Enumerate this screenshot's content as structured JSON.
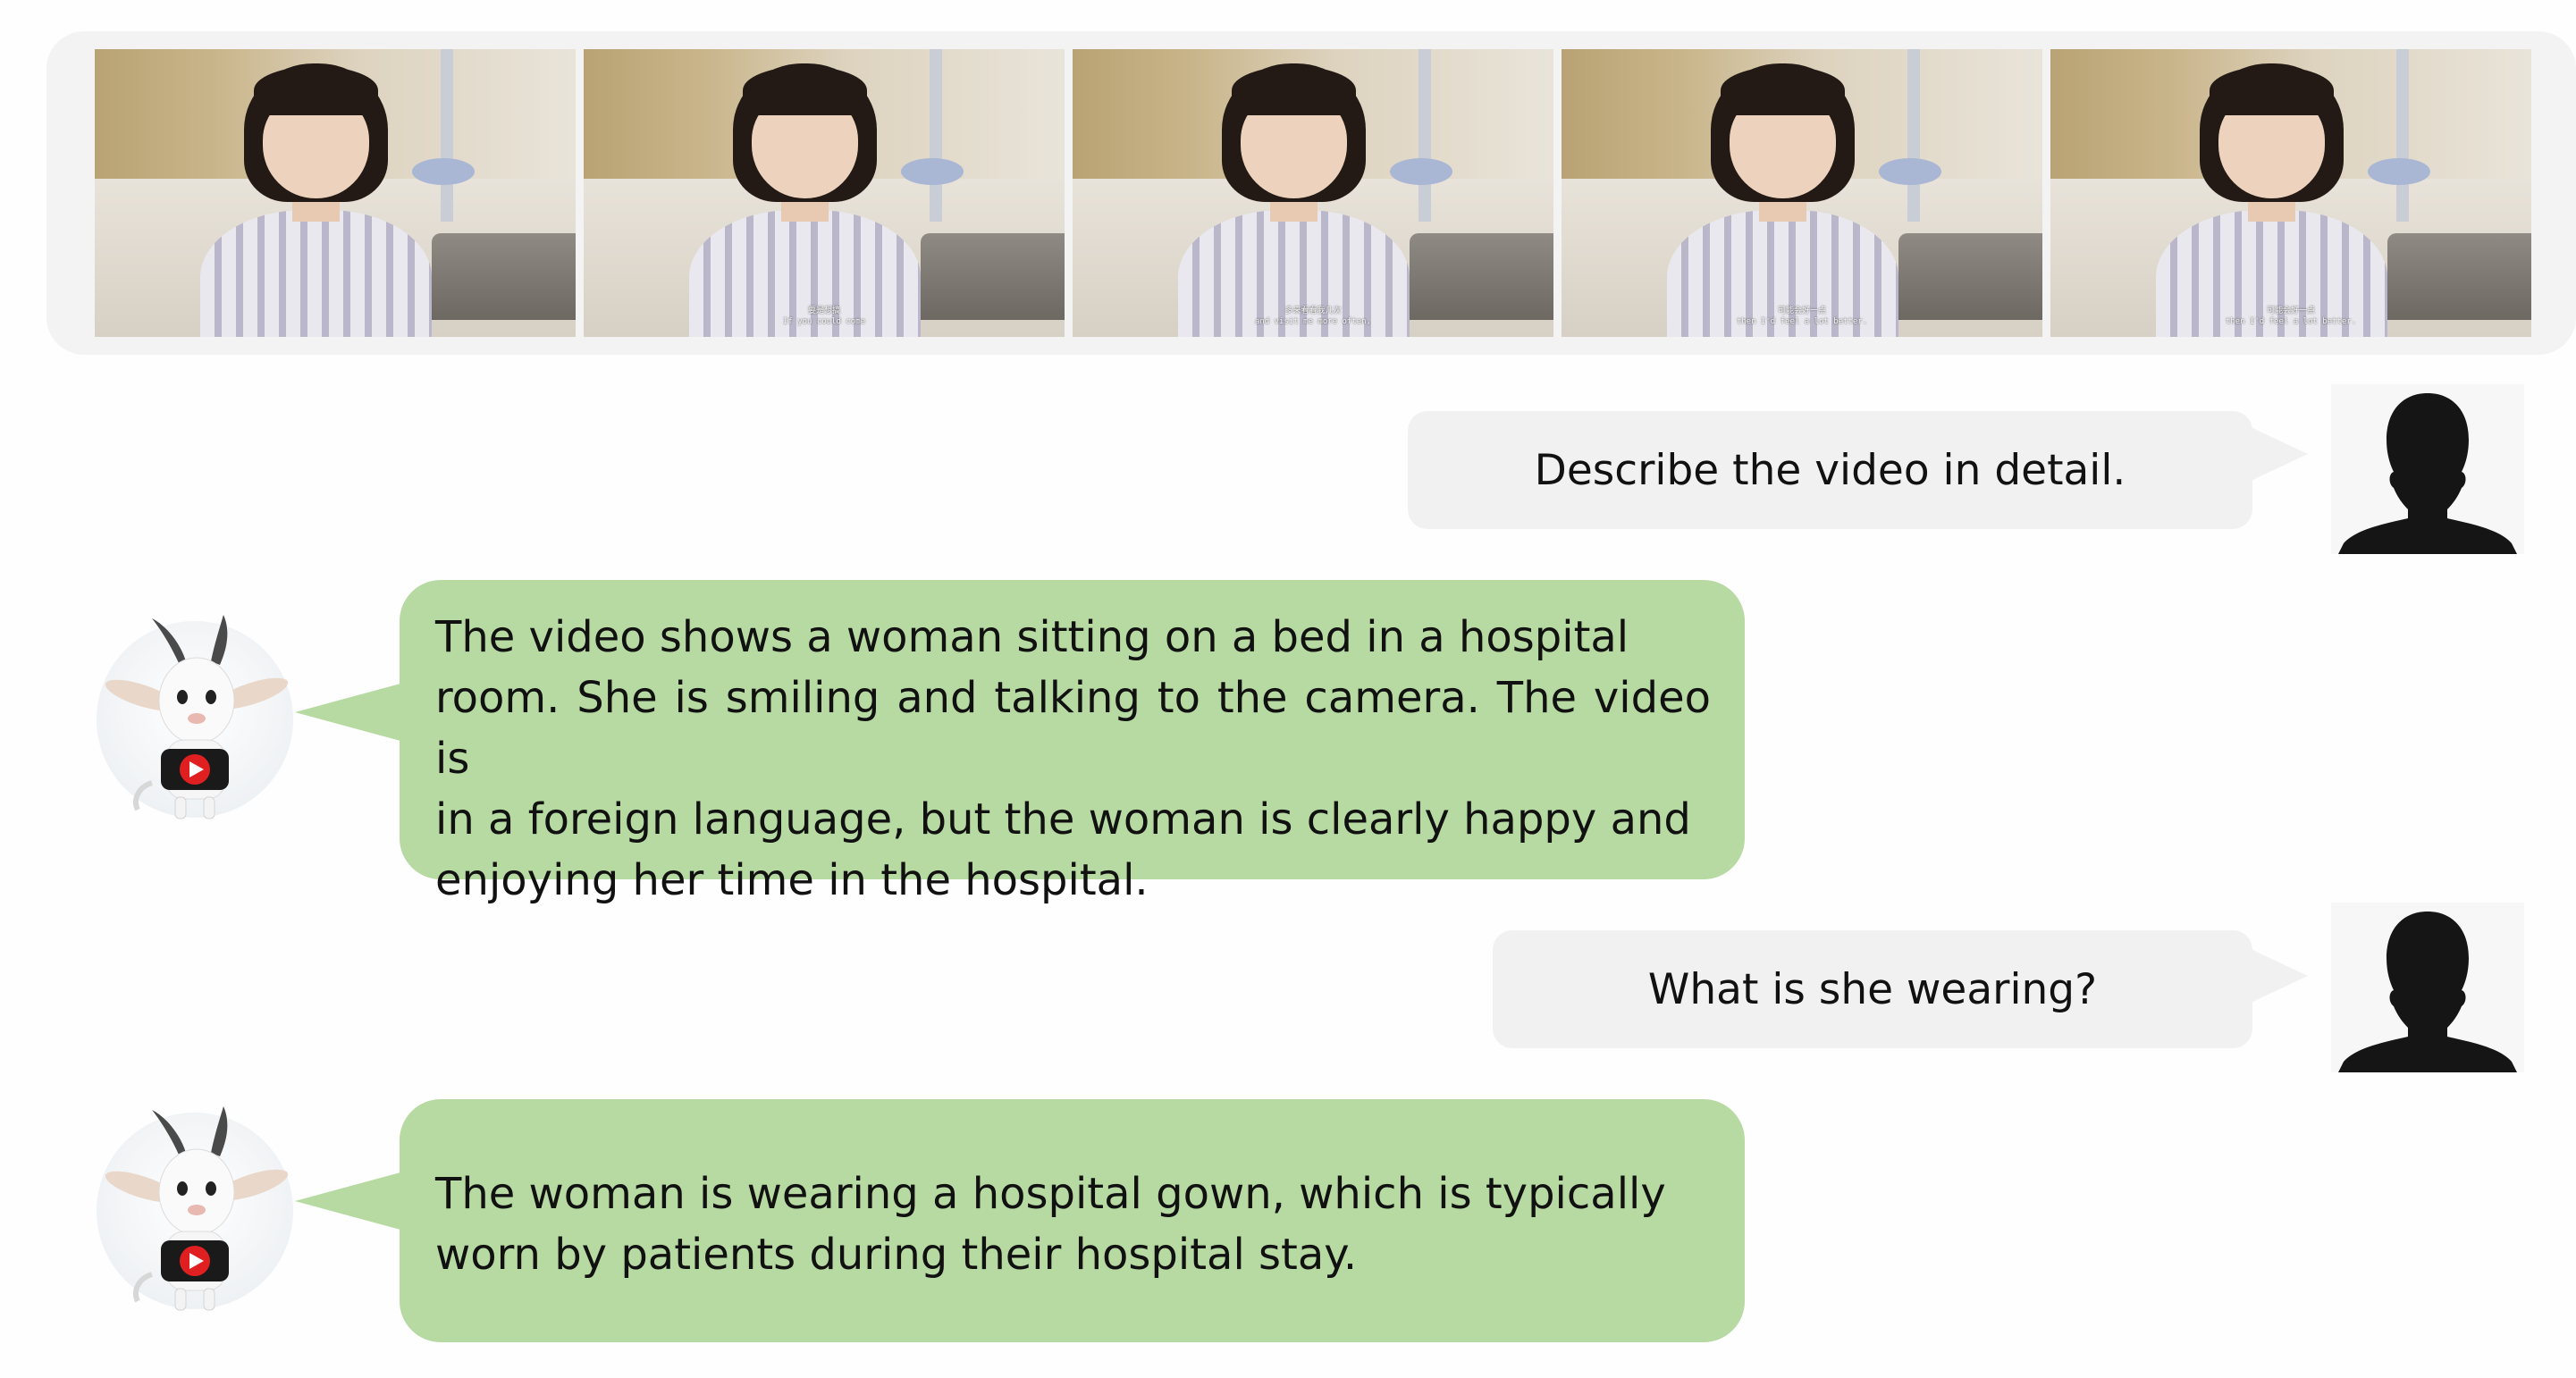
{
  "video": {
    "frames": [
      {
        "sub_zh": "",
        "sub_en": ""
      },
      {
        "sub_zh": "要是想搞",
        "sub_en": "If you could come"
      },
      {
        "sub_zh": "多来看看我几次",
        "sub_en": "and visit me more often,"
      },
      {
        "sub_zh": "可能会好一点",
        "sub_en": "then I'd feel a lot better."
      },
      {
        "sub_zh": "可能会好一点",
        "sub_en": "then I'd feel a lot better."
      }
    ]
  },
  "chat": [
    {
      "role": "user",
      "text": "Describe the video in detail.",
      "avatar_icon": "user-silhouette-icon"
    },
    {
      "role": "assistant",
      "avatar_icon": "goat-mascot-icon",
      "lines": [
        "The video shows a woman sitting on a bed in a hospital",
        "room. She is smiling and talking to the camera. The video is",
        "in a foreign language, but the woman is clearly happy and",
        "enjoying her time in the hospital."
      ]
    },
    {
      "role": "user",
      "text": "What is she wearing?",
      "avatar_icon": "user-silhouette-icon"
    },
    {
      "role": "assistant",
      "avatar_icon": "goat-mascot-icon",
      "lines": [
        "The woman is wearing a hospital gown, which is typically",
        "worn by patients during their hospital stay."
      ]
    }
  ],
  "colors": {
    "user_bubble": "#f1f1f1",
    "assistant_bubble": "#b7d9a2",
    "strip_background": "#f3f3f3",
    "play_button": "#e02020"
  }
}
